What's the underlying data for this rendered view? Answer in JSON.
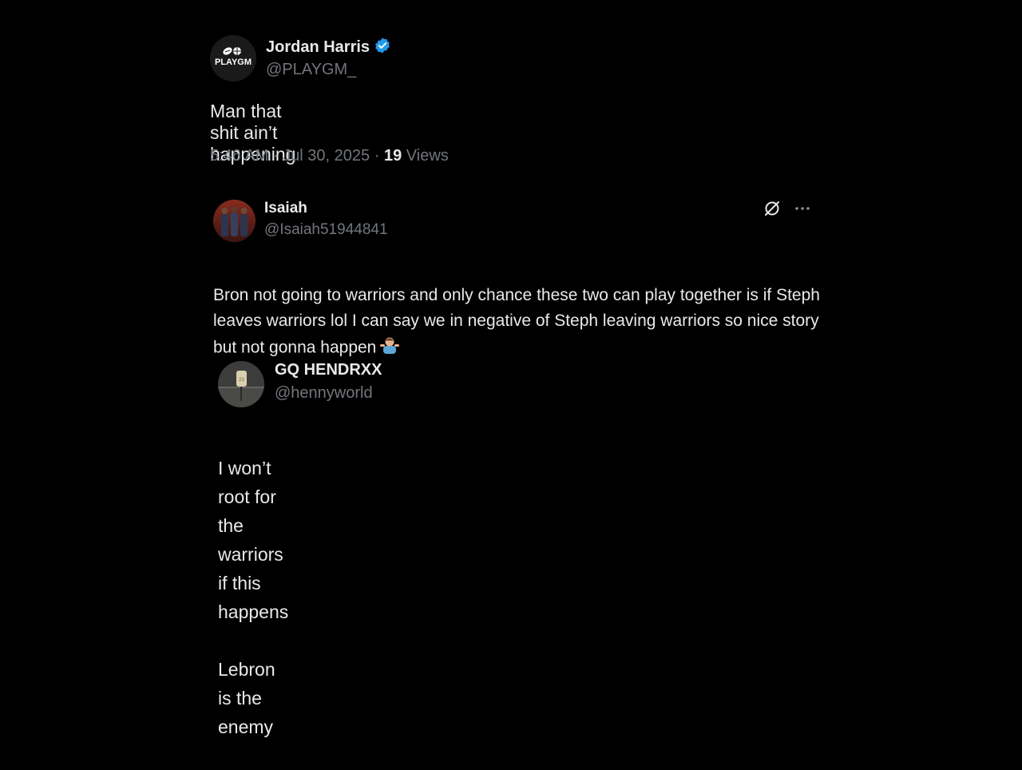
{
  "colors": {
    "background": "#000000",
    "primary_text": "#e7e9ea",
    "secondary_text": "#71767b",
    "verified_badge": "#1d9bf0"
  },
  "main_tweet": {
    "avatar_text": "PLAYGM",
    "display_name": "Jordan Harris",
    "verified": true,
    "handle": "@PLAYGM_",
    "text": "Man that shit ain’t happening",
    "time": "5:46 AM",
    "date": "Jul 30, 2025",
    "separator": "·",
    "views_count": "19",
    "views_label": "Views"
  },
  "reply_tweet": {
    "display_name": "Isaiah",
    "handle": "@Isaiah51944841",
    "text": "Bron not going to warriors and only chance these two can play together is if Steph leaves warriors lol I can say we in negative of Steph leaving warriors so nice story but not gonna happen",
    "emoji": "person-shrugging",
    "actions": [
      "grok-icon",
      "more-icon"
    ]
  },
  "quoted_tweet": {
    "display_name": "GQ HENDRXX",
    "handle": "@hennyworld",
    "text_line1": "I won’t root for the warriors if this happens",
    "text_line2": "Lebron is the enemy"
  }
}
